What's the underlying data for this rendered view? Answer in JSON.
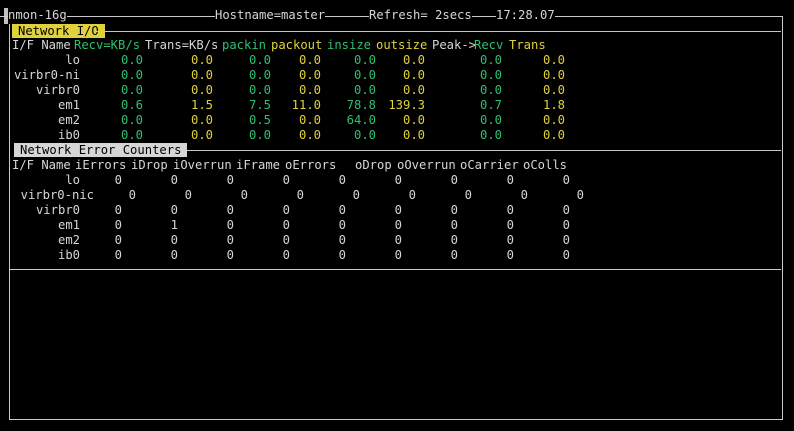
{
  "header": {
    "app": "nmon-16g",
    "hostname": "Hostname=master",
    "refresh": "Refresh= 2secs",
    "time": "17:28.07"
  },
  "io": {
    "section_label": "Network I/O",
    "headers": {
      "ifname": "I/F Name",
      "recv": "Recv=KB/s",
      "trans": "Trans=KB/s",
      "packin": "packin",
      "packout": "packout",
      "insize": "insize",
      "outsize": "outsize",
      "peak": "Peak->",
      "peak_recv": "Recv",
      "peak_trans": "Trans"
    },
    "rows": [
      {
        "name": "lo",
        "recv": "0.0",
        "trans": "0.0",
        "packin": "0.0",
        "packout": "0.0",
        "insize": "0.0",
        "outsize": "0.0",
        "peak_recv": "0.0",
        "peak_trans": "0.0"
      },
      {
        "name": "virbr0-ni",
        "recv": "0.0",
        "trans": "0.0",
        "packin": "0.0",
        "packout": "0.0",
        "insize": "0.0",
        "outsize": "0.0",
        "peak_recv": "0.0",
        "peak_trans": "0.0"
      },
      {
        "name": "virbr0",
        "recv": "0.0",
        "trans": "0.0",
        "packin": "0.0",
        "packout": "0.0",
        "insize": "0.0",
        "outsize": "0.0",
        "peak_recv": "0.0",
        "peak_trans": "0.0"
      },
      {
        "name": "em1",
        "recv": "0.6",
        "trans": "1.5",
        "packin": "7.5",
        "packout": "11.0",
        "insize": "78.8",
        "outsize": "139.3",
        "peak_recv": "0.7",
        "peak_trans": "1.8"
      },
      {
        "name": "em2",
        "recv": "0.0",
        "trans": "0.0",
        "packin": "0.5",
        "packout": "0.0",
        "insize": "64.0",
        "outsize": "0.0",
        "peak_recv": "0.0",
        "peak_trans": "0.0"
      },
      {
        "name": "ib0",
        "recv": "0.0",
        "trans": "0.0",
        "packin": "0.0",
        "packout": "0.0",
        "insize": "0.0",
        "outsize": "0.0",
        "peak_recv": "0.0",
        "peak_trans": "0.0"
      }
    ]
  },
  "errors": {
    "section_label": "Network Error Counters",
    "headers": {
      "ifname": "I/F Name",
      "ierrors": "iErrors",
      "idrop": "iDrop",
      "ioverrun": "iOverrun",
      "iframe": "iFrame",
      "oerrors": "oErrors",
      "odrop": "oDrop",
      "ooverrun": "oOverrun",
      "ocarrier": "oCarrier",
      "ocolls": "oColls"
    },
    "rows": [
      {
        "name": "lo",
        "v": [
          "0",
          "0",
          "0",
          "0",
          "0",
          "0",
          "0",
          "0",
          "0"
        ]
      },
      {
        "name": "virbr0-nic",
        "v": [
          "0",
          "0",
          "0",
          "0",
          "0",
          "0",
          "0",
          "0",
          "0"
        ]
      },
      {
        "name": "virbr0",
        "v": [
          "0",
          "0",
          "0",
          "0",
          "0",
          "0",
          "0",
          "0",
          "0"
        ]
      },
      {
        "name": "em1",
        "v": [
          "0",
          "1",
          "0",
          "0",
          "0",
          "0",
          "0",
          "0",
          "0"
        ]
      },
      {
        "name": "em2",
        "v": [
          "0",
          "0",
          "0",
          "0",
          "0",
          "0",
          "0",
          "0",
          "0"
        ]
      },
      {
        "name": "ib0",
        "v": [
          "0",
          "0",
          "0",
          "0",
          "0",
          "0",
          "0",
          "0",
          "0"
        ]
      }
    ]
  },
  "colors": {
    "green": "#2fbf71",
    "yellow": "#e0d23a",
    "text": "#d6d6d6",
    "background": "#000000"
  }
}
